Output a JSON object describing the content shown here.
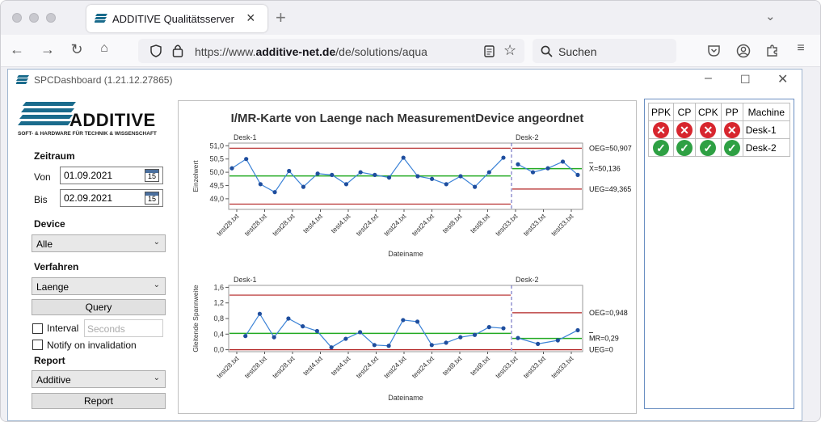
{
  "browser": {
    "tab_title": "ADDITIVE Qualitätsserver",
    "url_prefix": "https://www.",
    "url_domain": "additive-net.de",
    "url_path": "/de/solutions/aqua",
    "search_placeholder": "Suchen",
    "new_tab": "+",
    "tab_close": "×"
  },
  "app": {
    "title": "SPCDashboard (1.21.12.27865)",
    "logo_text": "ADDITIVE",
    "logo_tagline": "SOFT- & HARDWARE FÜR TECHNIK & WISSENSCHAFT"
  },
  "left": {
    "zeitraum_label": "Zeitraum",
    "von_label": "Von",
    "von_value": "01.09.2021",
    "bis_label": "Bis",
    "bis_value": "02.09.2021",
    "cal_icon_text": "15",
    "device_label": "Device",
    "device_value": "Alle",
    "verfahren_label": "Verfahren",
    "verfahren_value": "Laenge",
    "query_button": "Query",
    "interval_label": "Interval",
    "seconds_placeholder": "Seconds",
    "notify_label": "Notify on invalidation",
    "report_label": "Report",
    "report_value": "Additive",
    "report_button": "Report"
  },
  "table": {
    "headers": [
      "PPK",
      "CP",
      "CPK",
      "PP",
      "Machine"
    ],
    "rows": [
      {
        "status": "bad",
        "machine": "Desk-1"
      },
      {
        "status": "good",
        "machine": "Desk-2"
      }
    ]
  },
  "chart_data": [
    {
      "type": "line",
      "title": "I/MR-Karte von Laenge nach MeasurementDevice angeordnet",
      "ylabel": "Einzelwert",
      "xlabel": "Dateiname",
      "ylim": [
        48.6,
        51.1
      ],
      "yticks": [
        "51,0",
        "50,5",
        "50,0",
        "49,5",
        "49,0"
      ],
      "groups": [
        "Desk-1",
        "Desk-2"
      ],
      "x_ticks": [
        "test28.txt",
        "test28.txt",
        "test28.txt",
        "test4.txt",
        "test4.txt",
        "test24.txt",
        "test24.txt",
        "test24.txt",
        "test8.txt",
        "test8.txt",
        "test33.txt",
        "test33.txt",
        "test33.txt"
      ],
      "values_desk1": [
        50.15,
        50.5,
        49.55,
        49.25,
        50.05,
        49.45,
        49.95,
        49.9,
        49.55,
        50.0,
        49.9,
        49.8,
        50.55,
        49.85,
        49.75,
        49.55,
        49.85,
        49.45,
        50.0,
        50.55
      ],
      "values_desk2": [
        50.3,
        50.0,
        50.15,
        50.4,
        49.9
      ],
      "desk1_lines": {
        "oeg": 50.907,
        "mean": 49.86,
        "ueg": 48.8
      },
      "desk2_lines": {
        "oeg": 50.907,
        "mean": 50.136,
        "ueg": 49.365
      },
      "annotations": [
        "OEG=50,907",
        "X=50,136",
        "UEG=49,365"
      ]
    },
    {
      "type": "line",
      "ylabel": "Gleitende Spannweite",
      "xlabel": "Dateiname",
      "ylim": [
        -0.05,
        1.65
      ],
      "yticks": [
        "1,6",
        "1,2",
        "0,8",
        "0,4",
        "0,0"
      ],
      "groups": [
        "Desk-1",
        "Desk-2"
      ],
      "x_ticks": [
        "test28.txt",
        "test28.txt",
        "test28.txt",
        "test4.txt",
        "test4.txt",
        "test24.txt",
        "test24.txt",
        "test24.txt",
        "test8.txt",
        "test8.txt",
        "test33.txt",
        "test33.txt",
        "test33.txt"
      ],
      "values_desk1": [
        0.35,
        0.92,
        0.32,
        0.8,
        0.6,
        0.48,
        0.06,
        0.28,
        0.45,
        0.12,
        0.1,
        0.76,
        0.72,
        0.12,
        0.18,
        0.32,
        0.38,
        0.58,
        0.55
      ],
      "values_desk2": [
        0.3,
        0.15,
        0.24,
        0.5
      ],
      "desk1_lines": {
        "oeg": 1.4,
        "mean": 0.42,
        "ueg": 0.0
      },
      "desk2_lines": {
        "oeg": 0.948,
        "mean": 0.29,
        "ueg": 0.0
      },
      "annotations": [
        "OEG=0,948",
        "MR=0,29",
        "UEG=0"
      ]
    }
  ]
}
